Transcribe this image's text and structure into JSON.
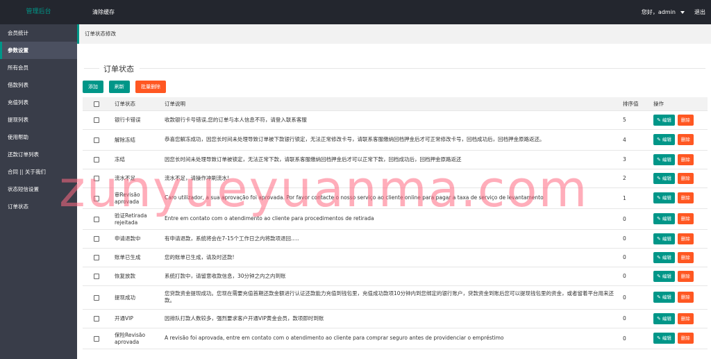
{
  "app": {
    "brand": "管理后台",
    "clear_cache": "清除缓存",
    "greeting": "您好，admin",
    "logout": "退出"
  },
  "sidebar": {
    "items": [
      {
        "label": "会员统计",
        "active": false
      },
      {
        "label": "参数设置",
        "active": true
      },
      {
        "label": "所有会员",
        "active": false
      },
      {
        "label": "借款列表",
        "active": false
      },
      {
        "label": "充值列表",
        "active": false
      },
      {
        "label": "提现列表",
        "active": false
      },
      {
        "label": "使用帮助",
        "active": false
      },
      {
        "label": "还款订单列表",
        "active": false
      },
      {
        "label": "合同 || 关于我们",
        "active": false
      },
      {
        "label": "状态短信设置",
        "active": false
      },
      {
        "label": "订单状态",
        "active": false
      }
    ]
  },
  "breadcrumb": "订单状态修改",
  "section_title": "订单状态",
  "toolbar": {
    "add": "添加",
    "refresh": "刷新",
    "batch_delete": "批量删除"
  },
  "table": {
    "headers": {
      "status": "订单状态",
      "desc": "订单说明",
      "sort": "排序值",
      "ops": "操作"
    },
    "edit_label": "编辑",
    "delete_label": "删除",
    "rows": [
      {
        "status": "银行卡错误",
        "desc": "收款银行卡号错误,您的订单与本人信息不符，请登入联系客服",
        "sort": "5"
      },
      {
        "status": "解除冻结",
        "desc": "恭喜您解冻成功，因您长时间未处理导致订单被下款银行锁定，无法正常修改卡号，请联系客服缴纳回档押金后才可正常修改卡号，回档成功后，回档押金原路返还。",
        "sort": "4"
      },
      {
        "status": "冻结",
        "desc": "因您长时间未处理导致订单被锁定，无法正常下款，请联系客服缴纳回档押金后才可以正常下款，回档成功后，回档押金原路返还",
        "sort": "3"
      },
      {
        "status": "流水不足",
        "desc": "流水不足，请操作冲刷流水!",
        "sort": "2"
      },
      {
        "status": "审Revisão aprovada",
        "desc": "Caro utilizador, a sua aprovação foi aprovada. Por favor contacte o nosso serviço ao cliente online para pagar a taxa de serviço de levantamento",
        "sort": "1"
      },
      {
        "status": "验证Retirada rejeitada",
        "desc": "Entre em contato com o atendimento ao cliente para procedimentos de retirada",
        "sort": "0"
      },
      {
        "status": "申请退款中",
        "desc": "有申请退款，系统将会在7-15个工作日之内将款项退回.....",
        "sort": "0"
      },
      {
        "status": "账单已生成",
        "desc": "您的账单已生成，请及时还款!",
        "sort": "0"
      },
      {
        "status": "恢复放款",
        "desc": "系统打款中，请留意收款信息，30分钟之内之内到账",
        "sort": "0"
      },
      {
        "status": "提现成功",
        "desc": "您贷款资金提现成功。您现在需要充值首期还款金额进行认证还款能力充值到钱包里，充值成功款项10分钟内到您绑定的银行账户，贷款资金到账后您可以提现钱包里的资金，或者留着平台用来还款。",
        "sort": "0"
      },
      {
        "status": "开通VIP",
        "desc": "因排队打款人数较多，强烈要求客户开通VIP黄金会员，款项即时到账",
        "sort": "0"
      },
      {
        "status": "保险Revisão aprovada",
        "desc": "A revisão foi aprovada, entre em contato com o atendimento ao cliente para comprar seguro antes de providenciar o empréstimo",
        "sort": "0"
      }
    ]
  },
  "watermark": "zunyueyuanma.com",
  "colors": {
    "accent": "#009688",
    "danger": "#ff5722",
    "topbar": "#23262e",
    "sidebar": "#393d49"
  }
}
